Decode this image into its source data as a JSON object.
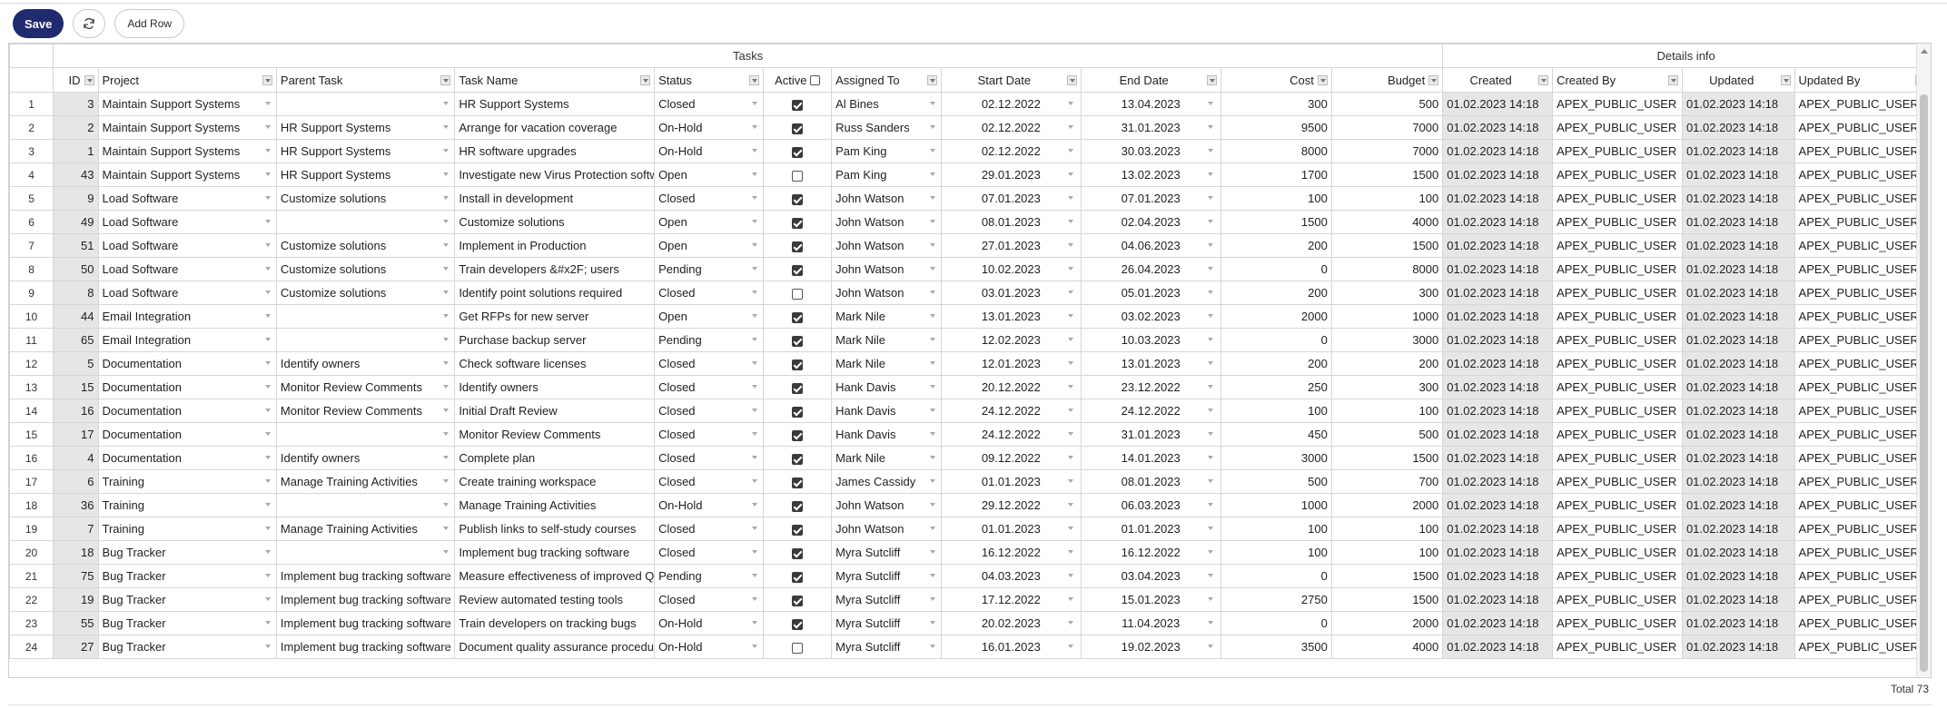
{
  "toolbar": {
    "save_label": "Save",
    "refresh_icon": "refresh-icon",
    "add_row_label": "Add Row"
  },
  "groups": {
    "tasks": "Tasks",
    "details": "Details info"
  },
  "columns": {
    "id": "ID",
    "project": "Project",
    "parent": "Parent Task",
    "task": "Task Name",
    "status": "Status",
    "active": "Active",
    "assigned": "Assigned To",
    "start": "Start Date",
    "end": "End Date",
    "cost": "Cost",
    "budget": "Budget",
    "created": "Created",
    "created_by": "Created By",
    "updated": "Updated",
    "updated_by": "Updated By"
  },
  "rows": [
    {
      "n": "1",
      "id": "3",
      "project": "Maintain Support Systems",
      "parent": "",
      "task": "HR Support Systems",
      "status": "Closed",
      "active": true,
      "assigned": "Al Bines",
      "start": "02.12.2022",
      "end": "13.04.2023",
      "cost": "300",
      "budget": "500"
    },
    {
      "n": "2",
      "id": "2",
      "project": "Maintain Support Systems",
      "parent": "HR Support Systems",
      "task": "Arrange for vacation coverage",
      "status": "On-Hold",
      "active": true,
      "assigned": "Russ Sanders",
      "start": "02.12.2022",
      "end": "31.01.2023",
      "cost": "9500",
      "budget": "7000"
    },
    {
      "n": "3",
      "id": "1",
      "project": "Maintain Support Systems",
      "parent": "HR Support Systems",
      "task": "HR software upgrades",
      "status": "On-Hold",
      "active": true,
      "assigned": "Pam King",
      "start": "02.12.2022",
      "end": "30.03.2023",
      "cost": "8000",
      "budget": "7000"
    },
    {
      "n": "4",
      "id": "43",
      "project": "Maintain Support Systems",
      "parent": "HR Support Systems",
      "task": "Investigate new Virus Protection software",
      "status": "Open",
      "active": false,
      "assigned": "Pam King",
      "start": "29.01.2023",
      "end": "13.02.2023",
      "cost": "1700",
      "budget": "1500"
    },
    {
      "n": "5",
      "id": "9",
      "project": "Load Software",
      "parent": "Customize solutions",
      "task": "Install in development",
      "status": "Closed",
      "active": true,
      "assigned": "John Watson",
      "start": "07.01.2023",
      "end": "07.01.2023",
      "cost": "100",
      "budget": "100"
    },
    {
      "n": "6",
      "id": "49",
      "project": "Load Software",
      "parent": "",
      "task": "Customize solutions",
      "status": "Open",
      "active": true,
      "assigned": "John Watson",
      "start": "08.01.2023",
      "end": "02.04.2023",
      "cost": "1500",
      "budget": "4000"
    },
    {
      "n": "7",
      "id": "51",
      "project": "Load Software",
      "parent": "Customize solutions",
      "task": "Implement in Production",
      "status": "Open",
      "active": true,
      "assigned": "John Watson",
      "start": "27.01.2023",
      "end": "04.06.2023",
      "cost": "200",
      "budget": "1500"
    },
    {
      "n": "8",
      "id": "50",
      "project": "Load Software",
      "parent": "Customize solutions",
      "task": "Train developers &#x2F; users",
      "status": "Pending",
      "active": true,
      "assigned": "John Watson",
      "start": "10.02.2023",
      "end": "26.04.2023",
      "cost": "0",
      "budget": "8000"
    },
    {
      "n": "9",
      "id": "8",
      "project": "Load Software",
      "parent": "Customize solutions",
      "task": "Identify point solutions required",
      "status": "Closed",
      "active": false,
      "assigned": "John Watson",
      "start": "03.01.2023",
      "end": "05.01.2023",
      "cost": "200",
      "budget": "300"
    },
    {
      "n": "10",
      "id": "44",
      "project": "Email Integration",
      "parent": "",
      "task": "Get RFPs for new server",
      "status": "Open",
      "active": true,
      "assigned": "Mark Nile",
      "start": "13.01.2023",
      "end": "03.02.2023",
      "cost": "2000",
      "budget": "1000"
    },
    {
      "n": "11",
      "id": "65",
      "project": "Email Integration",
      "parent": "",
      "task": "Purchase backup server",
      "status": "Pending",
      "active": true,
      "assigned": "Mark Nile",
      "start": "12.02.2023",
      "end": "10.03.2023",
      "cost": "0",
      "budget": "3000"
    },
    {
      "n": "12",
      "id": "5",
      "project": "Documentation",
      "parent": "Identify owners",
      "task": "Check software licenses",
      "status": "Closed",
      "active": true,
      "assigned": "Mark Nile",
      "start": "12.01.2023",
      "end": "13.01.2023",
      "cost": "200",
      "budget": "200"
    },
    {
      "n": "13",
      "id": "15",
      "project": "Documentation",
      "parent": "Monitor Review Comments",
      "task": "Identify owners",
      "status": "Closed",
      "active": true,
      "assigned": "Hank Davis",
      "start": "20.12.2022",
      "end": "23.12.2022",
      "cost": "250",
      "budget": "300"
    },
    {
      "n": "14",
      "id": "16",
      "project": "Documentation",
      "parent": "Monitor Review Comments",
      "task": "Initial Draft Review",
      "status": "Closed",
      "active": true,
      "assigned": "Hank Davis",
      "start": "24.12.2022",
      "end": "24.12.2022",
      "cost": "100",
      "budget": "100"
    },
    {
      "n": "15",
      "id": "17",
      "project": "Documentation",
      "parent": "",
      "task": "Monitor Review Comments",
      "status": "Closed",
      "active": true,
      "assigned": "Hank Davis",
      "start": "24.12.2022",
      "end": "31.01.2023",
      "cost": "450",
      "budget": "500"
    },
    {
      "n": "16",
      "id": "4",
      "project": "Documentation",
      "parent": "Identify owners",
      "task": "Complete plan",
      "status": "Closed",
      "active": true,
      "assigned": "Mark Nile",
      "start": "09.12.2022",
      "end": "14.01.2023",
      "cost": "3000",
      "budget": "1500"
    },
    {
      "n": "17",
      "id": "6",
      "project": "Training",
      "parent": "Manage Training Activities",
      "task": "Create training workspace",
      "status": "Closed",
      "active": true,
      "assigned": "James Cassidy",
      "start": "01.01.2023",
      "end": "08.01.2023",
      "cost": "500",
      "budget": "700"
    },
    {
      "n": "18",
      "id": "36",
      "project": "Training",
      "parent": "",
      "task": "Manage Training Activities",
      "status": "On-Hold",
      "active": true,
      "assigned": "John Watson",
      "start": "29.12.2022",
      "end": "06.03.2023",
      "cost": "1000",
      "budget": "2000"
    },
    {
      "n": "19",
      "id": "7",
      "project": "Training",
      "parent": "Manage Training Activities",
      "task": "Publish links to self-study courses",
      "status": "Closed",
      "active": true,
      "assigned": "John Watson",
      "start": "01.01.2023",
      "end": "01.01.2023",
      "cost": "100",
      "budget": "100"
    },
    {
      "n": "20",
      "id": "18",
      "project": "Bug Tracker",
      "parent": "",
      "task": "Implement bug tracking software",
      "status": "Closed",
      "active": true,
      "assigned": "Myra Sutcliff",
      "start": "16.12.2022",
      "end": "16.12.2022",
      "cost": "100",
      "budget": "100"
    },
    {
      "n": "21",
      "id": "75",
      "project": "Bug Tracker",
      "parent": "Implement bug tracking software",
      "task": "Measure effectiveness of improved QA",
      "status": "Pending",
      "active": true,
      "assigned": "Myra Sutcliff",
      "start": "04.03.2023",
      "end": "03.04.2023",
      "cost": "0",
      "budget": "1500"
    },
    {
      "n": "22",
      "id": "19",
      "project": "Bug Tracker",
      "parent": "Implement bug tracking software",
      "task": "Review automated testing tools",
      "status": "Closed",
      "active": true,
      "assigned": "Myra Sutcliff",
      "start": "17.12.2022",
      "end": "15.01.2023",
      "cost": "2750",
      "budget": "1500"
    },
    {
      "n": "23",
      "id": "55",
      "project": "Bug Tracker",
      "parent": "Implement bug tracking software",
      "task": "Train developers on tracking bugs",
      "status": "On-Hold",
      "active": true,
      "assigned": "Myra Sutcliff",
      "start": "20.02.2023",
      "end": "11.04.2023",
      "cost": "0",
      "budget": "2000"
    },
    {
      "n": "24",
      "id": "27",
      "project": "Bug Tracker",
      "parent": "Implement bug tracking software",
      "task": "Document quality assurance procedures",
      "status": "On-Hold",
      "active": false,
      "assigned": "Myra Sutcliff",
      "start": "16.01.2023",
      "end": "19.02.2023",
      "cost": "3500",
      "budget": "4000"
    }
  ],
  "audit": {
    "created": "01.02.2023 14:18",
    "created_by": "APEX_PUBLIC_USER",
    "updated": "01.02.2023 14:18",
    "updated_by": "APEX_PUBLIC_USER"
  },
  "footer": {
    "total": "Total 73"
  }
}
